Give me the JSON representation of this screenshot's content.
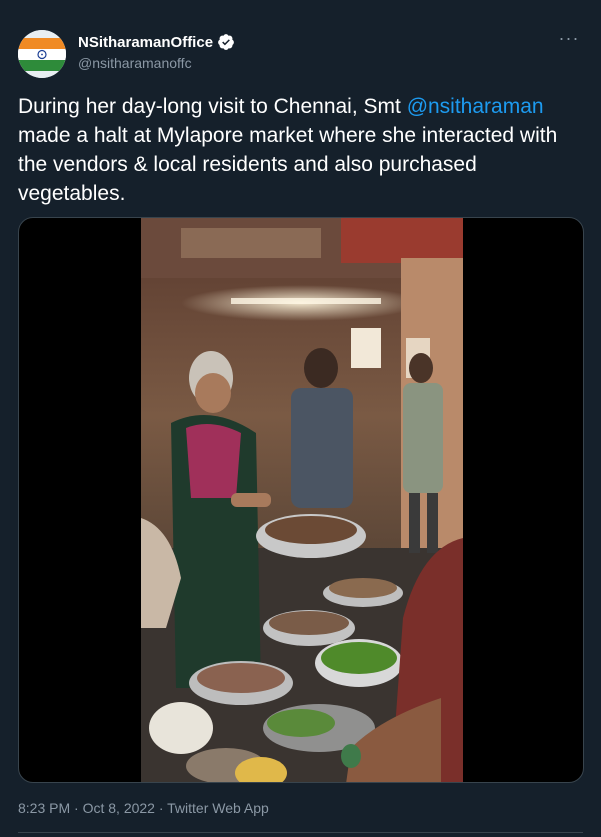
{
  "author": {
    "display_name": "NSitharamanOffice",
    "handle": "@nsitharamanoffc",
    "avatar_icon": "india-flag-avatar",
    "verified_icon": "verified-badge-icon"
  },
  "tweet": {
    "text_before": "During her day-long visit to Chennai, Smt ",
    "mention": "@nsitharaman",
    "text_after": " made a halt at Mylapore market where she interacted with the vendors & local residents and also purchased vegetables."
  },
  "media": {
    "type": "video",
    "scene": "market-vegetable-stall"
  },
  "footer": {
    "timestamp": "8:23 PM · Oct 8, 2022 · Twitter Web App"
  },
  "colors": {
    "background": "#15202b",
    "text": "#ffffff",
    "secondary": "#8b98a5",
    "link": "#1d9bf0",
    "border": "#38444d"
  }
}
